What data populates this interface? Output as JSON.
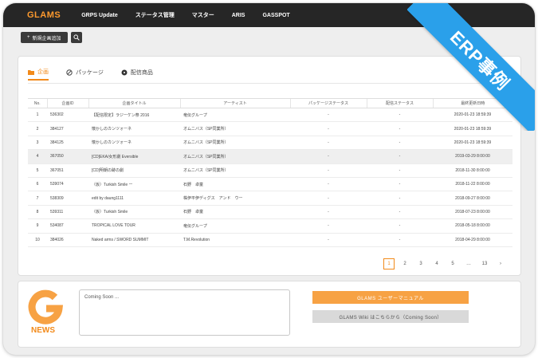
{
  "nav": {
    "logo": "GLAMS",
    "items": [
      "GRPS Update",
      "ステータス管理",
      "マスター",
      "ARIS",
      "GASSPOT"
    ]
  },
  "toolbar": {
    "new_label": "新規企画追加"
  },
  "tabs": [
    {
      "label": "企画",
      "icon": "folder-icon",
      "active": true
    },
    {
      "label": "パッケージ",
      "icon": "ban-icon",
      "active": false
    },
    {
      "label": "配信商品",
      "icon": "disc-icon",
      "active": false
    }
  ],
  "table": {
    "columns": [
      "No.",
      "企画ID",
      "企画タイトル",
      "アーティスト",
      "パッケージステータス",
      "配信ステータス",
      "最終更新日時"
    ],
    "rows": [
      [
        "1",
        "536302",
        "【配信限定】ラジーケン祭 2016",
        "竜伝グループ",
        "-",
        "-",
        "2020-01-23 18:59:39"
      ],
      [
        "2",
        "384127",
        "懐かしのカンツォーネ",
        "オムニバス（SP同業所）",
        "-",
        "-",
        "2020-01-23 18:59:39"
      ],
      [
        "3",
        "384125",
        "懐かしのカンツォーネ",
        "オムニバス（SP同業所）",
        "-",
        "-",
        "2020-01-23 18:59:39"
      ],
      [
        "4",
        "367050",
        "[CD]EKA/女形劇 Eversible",
        "オムニバス（SP同業所）",
        "-",
        "-",
        "2019-03-29 8:00:00"
      ],
      [
        "5",
        "367051",
        "[CD]明朝の跡の劇",
        "オムニバス（SP同業所）",
        "-",
        "-",
        "2018-11-30 8:00:00"
      ],
      [
        "6",
        "539074",
        "（仮）Turkish Smile ー",
        "石野　卓童",
        "-",
        "-",
        "2018-11-22 8:00:00"
      ],
      [
        "7",
        "538309",
        "edit by daung1111",
        "株伊平伊ディグス　アンド　ウー",
        "-",
        "-",
        "2018-09-27 8:00:00"
      ],
      [
        "8",
        "539311",
        "（仮）Turkish Smile",
        "石野　卓童",
        "-",
        "-",
        "2018-07-23 8:00:00"
      ],
      [
        "9",
        "534087",
        "TROPICAL LOVE TOUR",
        "竜伝グループ",
        "-",
        "-",
        "2018-05-18 8:00:00"
      ],
      [
        "10",
        "384026",
        "Naked arms / SWORD SUMMIT",
        "T.M.Revolution",
        "-",
        "-",
        "2018-04-29 8:00:00"
      ]
    ]
  },
  "pagination": {
    "pages": [
      "1",
      "2",
      "3",
      "4",
      "5",
      "…",
      "13"
    ],
    "active": "1",
    "next": "›"
  },
  "news": {
    "label": "NEWS",
    "text": "Coming Soon ...",
    "manual_button": "GLAMS ユーザーマニュアル",
    "wiki_button": "GLAMS Wiki はこちらから（Coming Soon）"
  },
  "ribbon": {
    "text": "ERP事例"
  },
  "colors": {
    "accent": "#f28a1a",
    "nav_bg": "#262626",
    "ribbon": "#2aa0ea"
  }
}
